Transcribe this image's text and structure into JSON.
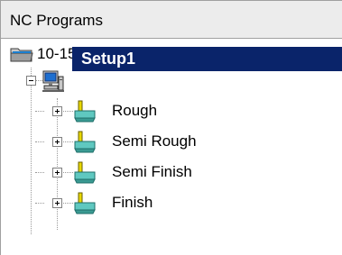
{
  "panel": {
    "title": "NC Programs"
  },
  "tree": {
    "root": {
      "label": "10-15-98 : Ejector - Mirrored",
      "icon": "folder-icon"
    },
    "setup": {
      "label": "Setup1",
      "icon": "setup-computer-icon",
      "expanded": true,
      "selected": true
    },
    "operations": [
      {
        "label": "Rough",
        "icon": "toolpath-icon",
        "expanded": false
      },
      {
        "label": "Semi Rough",
        "icon": "toolpath-icon",
        "expanded": false
      },
      {
        "label": "Semi Finish",
        "icon": "toolpath-icon",
        "expanded": false
      },
      {
        "label": "Finish",
        "icon": "toolpath-icon",
        "expanded": false
      }
    ]
  },
  "colors": {
    "selection": "#0a246a",
    "header_bg": "#ececec",
    "toolpath_teal": "#5fc8c0",
    "toolpath_yellow": "#e8d800"
  }
}
